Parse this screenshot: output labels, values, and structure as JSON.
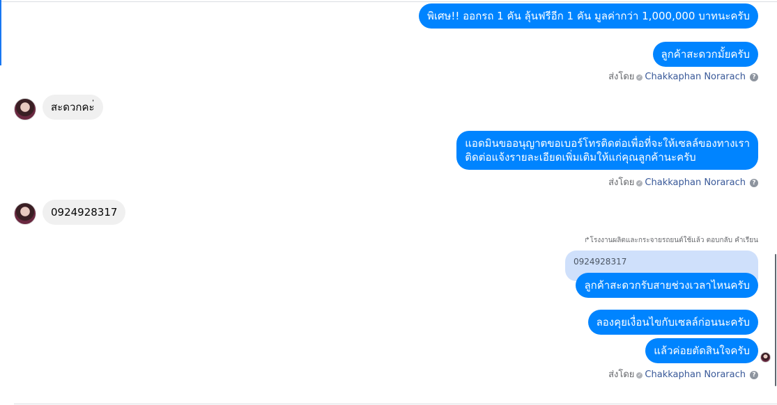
{
  "messages": {
    "m1": "พิเศษ!! ออกรถ 1 คัน ลุ้นฟรีอีก 1 คัน มูลค่ากว่า 1,000,000 บาทนะครับ",
    "m2": "ลูกค้าสะดวกมั้ยครับ",
    "m3": "สะดวกคะ่",
    "m4_line1": "แอดมินขออนุญาตขอเบอร์โทรติดต่อเพื่อที่จะให้เซลล์ของทางเรา",
    "m4_line2": "ติดต่อแจ้งรายละเอียดเพิ่มเติมให้แก่คุณลูกค้านะครับ",
    "m5": "0924928317",
    "reply_context": "↱โรงงานผลิตและกระจายรถยนต์ใช้แล้ว ตอบกลับ คำเรียน",
    "quoted": "0924928317",
    "m6": "ลูกค้าสะดวกรับสายช่วงเวลาไหนครับ",
    "m7": "ลองคุยเงื่อนไขกับเซลล์ก่อนนะครับ",
    "m8": "แล้วค่อยตัดสินใจครับ"
  },
  "sent_by": {
    "label": "ส่งโดย",
    "name": "Chakkaphan Norarach",
    "help": "?"
  },
  "colors": {
    "outgoing_bubble": "#0084ff",
    "incoming_bubble": "#f0f0f0",
    "quoted_bubble": "#cfe0fb"
  },
  "icons": [
    "check-circle-icon",
    "help-icon",
    "avatar",
    "seen-avatar"
  ]
}
